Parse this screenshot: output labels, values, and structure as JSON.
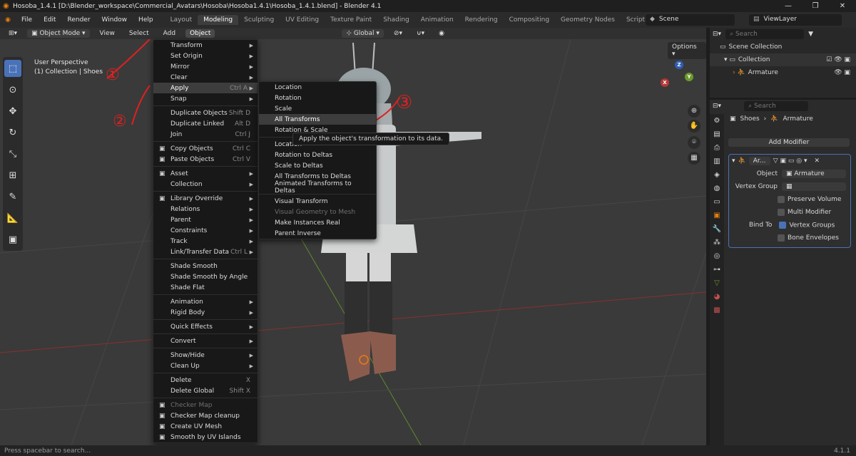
{
  "window": {
    "title": "Hosoba_1.4.1 [D:\\Blender_workspace\\Commercial_Avatars\\Hosoba\\Hosoba1.4.1\\Hosoba_1.4.1.blend] - Blender 4.1",
    "controls": [
      "—",
      "❐",
      "✕"
    ]
  },
  "menubar": {
    "items": [
      "File",
      "Edit",
      "Render",
      "Window",
      "Help"
    ],
    "tabs": [
      "Layout",
      "Modeling",
      "Sculpting",
      "UV Editing",
      "Texture Paint",
      "Shading",
      "Animation",
      "Rendering",
      "Compositing",
      "Geometry Nodes",
      "Scripting"
    ],
    "active_tab": "Modeling",
    "add_tab": "+",
    "scene": "Scene",
    "view_layer": "ViewLayer"
  },
  "viewport_header": {
    "mode": "Object Mode",
    "menus": [
      "View",
      "Select",
      "Add",
      "Object"
    ],
    "transform_orientation": "Global"
  },
  "viewport": {
    "perspective": "User Perspective",
    "collection_info": "(1) Collection | Shoes",
    "options": "Options",
    "gizmo_axes": [
      "X",
      "Y",
      "Z"
    ],
    "annotations": [
      "①",
      "②",
      "③"
    ]
  },
  "object_menu": {
    "items": [
      {
        "label": "Transform",
        "shortcut": "",
        "submenu": true
      },
      {
        "label": "Set Origin",
        "shortcut": "",
        "submenu": true
      },
      {
        "label": "Mirror",
        "shortcut": "",
        "submenu": true
      },
      {
        "label": "Clear",
        "shortcut": "",
        "submenu": true
      },
      {
        "label": "Apply",
        "shortcut": "Ctrl A",
        "submenu": true,
        "highlight": true
      },
      {
        "label": "Snap",
        "shortcut": "",
        "submenu": true,
        "sep_after": true
      },
      {
        "label": "Duplicate Objects",
        "shortcut": "Shift D"
      },
      {
        "label": "Duplicate Linked",
        "shortcut": "Alt D"
      },
      {
        "label": "Join",
        "shortcut": "Ctrl J",
        "sep_after": true
      },
      {
        "label": "Copy Objects",
        "shortcut": "Ctrl C",
        "icon": "copy-icon"
      },
      {
        "label": "Paste Objects",
        "shortcut": "Ctrl V",
        "icon": "paste-icon",
        "sep_after": true
      },
      {
        "label": "Asset",
        "shortcut": "",
        "submenu": true,
        "icon": "asset-icon"
      },
      {
        "label": "Collection",
        "shortcut": "",
        "submenu": true,
        "sep_after": true
      },
      {
        "label": "Library Override",
        "shortcut": "",
        "submenu": true,
        "icon": "library-icon"
      },
      {
        "label": "Relations",
        "shortcut": "",
        "submenu": true
      },
      {
        "label": "Parent",
        "shortcut": "",
        "submenu": true
      },
      {
        "label": "Constraints",
        "shortcut": "",
        "submenu": true
      },
      {
        "label": "Track",
        "shortcut": "",
        "submenu": true
      },
      {
        "label": "Link/Transfer Data",
        "shortcut": "Ctrl L",
        "submenu": true,
        "sep_after": true
      },
      {
        "label": "Shade Smooth",
        "shortcut": ""
      },
      {
        "label": "Shade Smooth by Angle",
        "shortcut": ""
      },
      {
        "label": "Shade Flat",
        "shortcut": "",
        "sep_after": true
      },
      {
        "label": "Animation",
        "shortcut": "",
        "submenu": true
      },
      {
        "label": "Rigid Body",
        "shortcut": "",
        "submenu": true,
        "sep_after": true
      },
      {
        "label": "Quick Effects",
        "shortcut": "",
        "submenu": true,
        "sep_after": true
      },
      {
        "label": "Convert",
        "shortcut": "",
        "submenu": true,
        "sep_after": true
      },
      {
        "label": "Show/Hide",
        "shortcut": "",
        "submenu": true
      },
      {
        "label": "Clean Up",
        "shortcut": "",
        "submenu": true,
        "sep_after": true
      },
      {
        "label": "Delete",
        "shortcut": "X"
      },
      {
        "label": "Delete Global",
        "shortcut": "Shift X",
        "sep_after": true
      },
      {
        "label": "Checker Map",
        "shortcut": "",
        "dim": true,
        "icon": "checker-icon"
      },
      {
        "label": "Checker Map cleanup",
        "shortcut": "",
        "icon": "checker-icon"
      },
      {
        "label": "Create UV Mesh",
        "shortcut": "",
        "icon": "uv-icon"
      },
      {
        "label": "Smooth by UV Islands",
        "shortcut": "",
        "icon": "uv-icon"
      }
    ]
  },
  "apply_submenu": {
    "items": [
      {
        "label": "Location"
      },
      {
        "label": "Rotation"
      },
      {
        "label": "Scale"
      },
      {
        "label": "All Transforms",
        "highlight": true
      },
      {
        "label": "Rotation & Scale"
      },
      {
        "label": "Location",
        "sep_before": true
      },
      {
        "label": "Rotation to Deltas"
      },
      {
        "label": "Scale to Deltas"
      },
      {
        "label": "All Transforms to Deltas"
      },
      {
        "label": "Animated Transforms to Deltas"
      },
      {
        "label": "Visual Transform",
        "sep_before": true
      },
      {
        "label": "Visual Geometry to Mesh",
        "dim": true
      },
      {
        "label": "Make Instances Real"
      },
      {
        "label": "Parent Inverse"
      }
    ]
  },
  "tooltip": "Apply the object's transformation to its data.",
  "outliner": {
    "search_placeholder": "Search",
    "root": "Scene Collection",
    "collection": "Collection",
    "object": "Armature"
  },
  "properties": {
    "search_placeholder": "Search",
    "breadcrumb_object": "Shoes",
    "breadcrumb_data": "Armature",
    "add_modifier": "Add Modifier",
    "modifier_name": "Ar...",
    "object_label": "Object",
    "object_value": "Armature",
    "vertex_group_label": "Vertex Group",
    "preserve_volume": "Preserve Volume",
    "multi_modifier": "Multi Modifier",
    "bind_to_label": "Bind To",
    "vertex_groups": "Vertex Groups",
    "bone_envelopes": "Bone Envelopes"
  },
  "status": {
    "hint": "Press spacebar to search...",
    "version": "4.1.1"
  },
  "colors": {
    "accent": "#4a72b8",
    "annotation_red": "#e02020"
  }
}
